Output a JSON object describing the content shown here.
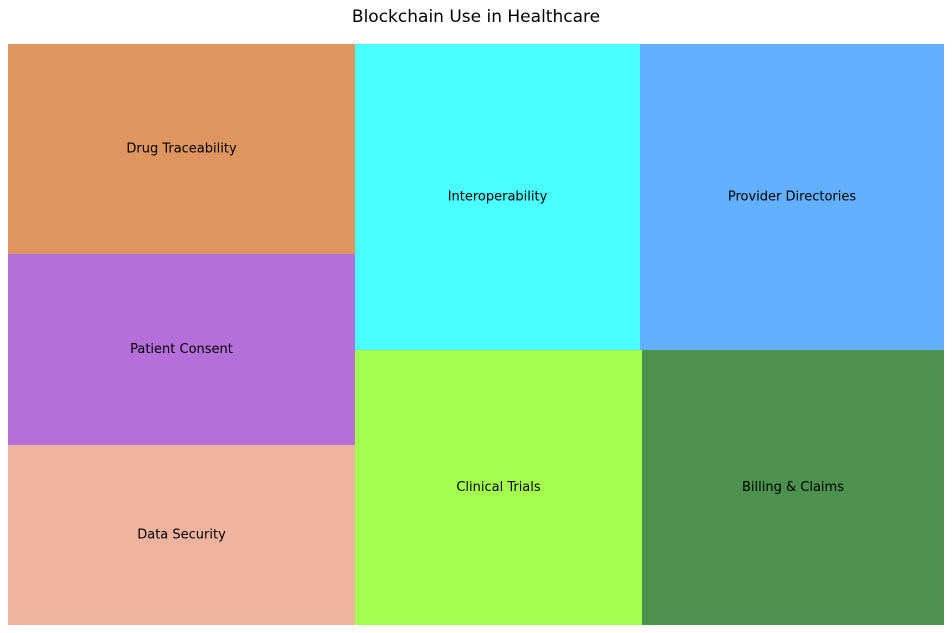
{
  "chart_data": {
    "type": "treemap",
    "title": "Blockchain Use in Healthcare",
    "items": [
      {
        "label": "Drug Traceability",
        "color": "#de955f"
      },
      {
        "label": "Patient Consent",
        "color": "#b46fda"
      },
      {
        "label": "Data Security",
        "color": "#f0b3a0"
      },
      {
        "label": "Interoperability",
        "color": "#4affff"
      },
      {
        "label": "Clinical Trials",
        "color": "#a5ff4f"
      },
      {
        "label": "Provider Directories",
        "color": "#62b0ff"
      },
      {
        "label": "Billing & Claims",
        "color": "#4c914d"
      }
    ]
  }
}
